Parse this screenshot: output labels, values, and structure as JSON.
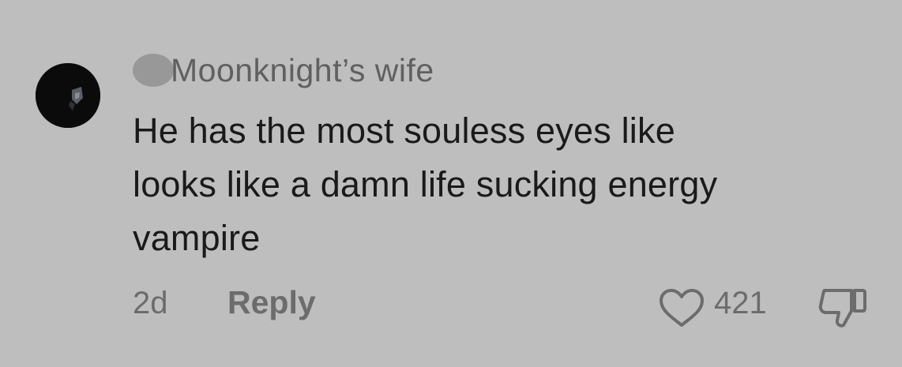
{
  "comment": {
    "username": "Moonknight’s wife",
    "text_lines": [
      "He has the most souless eyes like",
      "looks like a damn life sucking energy",
      "vampire"
    ],
    "timestamp": "2d",
    "reply_label": "Reply",
    "like_count": "421",
    "icons": {
      "avatar": "avatar-dark-portrait",
      "status": "status-dot-icon",
      "like": "heart-outline-icon",
      "dislike": "thumbs-down-outline-icon"
    },
    "colors": {
      "background": "#bebebe",
      "text": "#1a1a1a",
      "muted": "#6c6c6c"
    }
  }
}
